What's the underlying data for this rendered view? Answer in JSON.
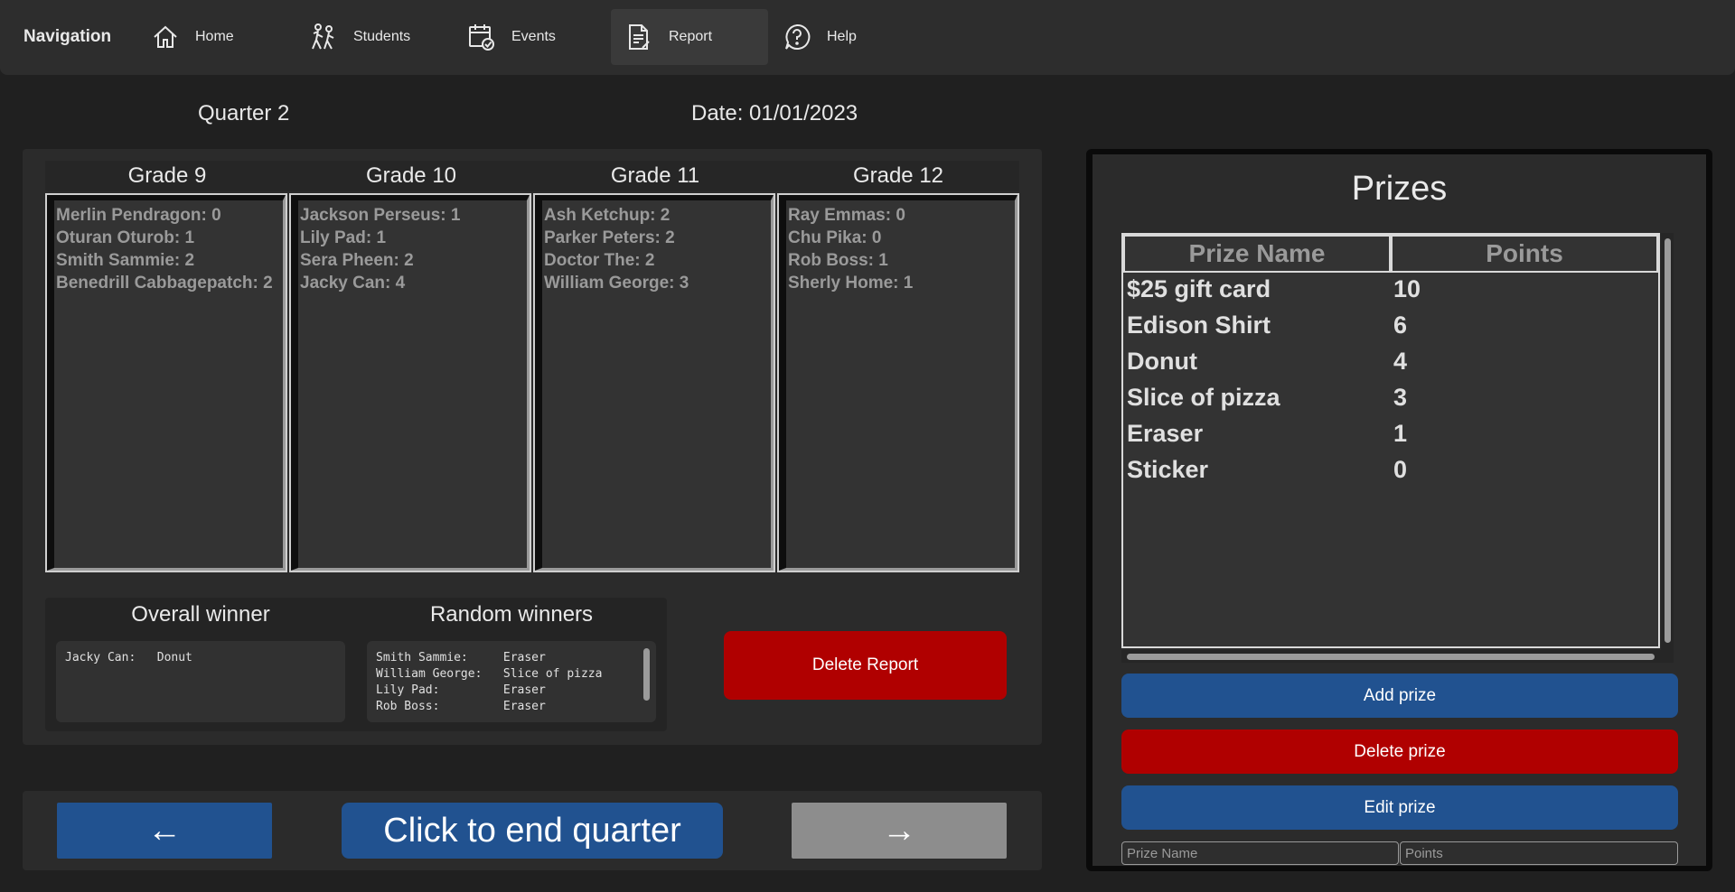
{
  "nav": {
    "title": "Navigation",
    "items": [
      {
        "label": "Home",
        "icon": "home-icon"
      },
      {
        "label": "Students",
        "icon": "students-icon"
      },
      {
        "label": "Events",
        "icon": "events-icon"
      },
      {
        "label": "Report",
        "icon": "report-icon",
        "active": true
      },
      {
        "label": "Help",
        "icon": "help-icon"
      }
    ]
  },
  "header": {
    "quarter": "Quarter 2",
    "date": "Date: 01/01/2023"
  },
  "grades": [
    {
      "title": "Grade 9",
      "students": [
        "Merlin Pendragon: 0",
        "Oturan Oturob: 1",
        "Smith Sammie: 2",
        "Benedrill Cabbagepatch: 2"
      ]
    },
    {
      "title": "Grade 10",
      "students": [
        "Jackson Perseus: 1",
        "Lily Pad: 1",
        "Sera Pheen: 2",
        "Jacky Can: 4"
      ]
    },
    {
      "title": "Grade 11",
      "students": [
        "Ash Ketchup: 2",
        "Parker Peters: 2",
        "Doctor The: 2",
        "William George: 3"
      ]
    },
    {
      "title": "Grade 12",
      "students": [
        "Ray Emmas: 0",
        "Chu Pika: 0",
        "Rob Boss: 1",
        "Sherly Home: 1"
      ]
    }
  ],
  "winners": {
    "overall_title": "Overall winner",
    "overall_text": "Jacky Can:   Donut",
    "random_title": "Random winners",
    "random_text": "Smith Sammie:     Eraser\nWilliam George:   Slice of pizza\nLily Pad:         Eraser\nRob Boss:         Eraser"
  },
  "buttons": {
    "delete_report": "Delete Report",
    "prev": "←",
    "end_quarter": "Click to end quarter",
    "next": "→",
    "add_prize": "Add prize",
    "delete_prize": "Delete prize",
    "edit_prize": "Edit prize"
  },
  "prizes": {
    "title": "Prizes",
    "columns": [
      "Prize Name",
      "Points"
    ],
    "rows": [
      {
        "name": "$25 gift card",
        "points": "10"
      },
      {
        "name": "Edison Shirt",
        "points": "6"
      },
      {
        "name": "Donut",
        "points": "4"
      },
      {
        "name": "Slice of pizza",
        "points": "3"
      },
      {
        "name": "Eraser",
        "points": "1"
      },
      {
        "name": "Sticker",
        "points": "0"
      }
    ],
    "name_placeholder": "Prize Name",
    "points_placeholder": "Points"
  },
  "colors": {
    "accent_blue": "#215290",
    "danger_red": "#b00000",
    "disabled_gray": "#8d8d8d",
    "background": "#202020"
  }
}
